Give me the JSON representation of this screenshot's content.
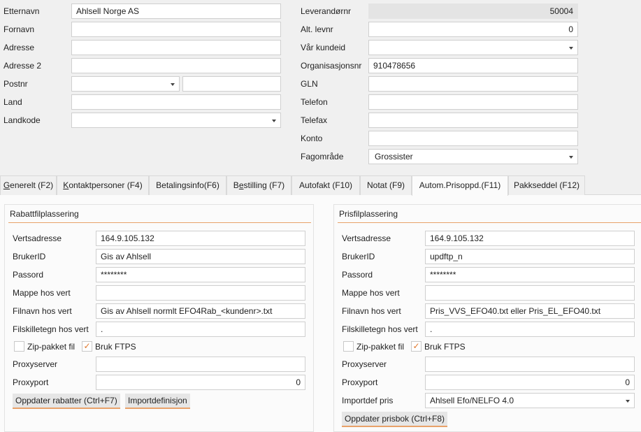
{
  "top_left": {
    "etternavn_label": "Etternavn",
    "etternavn_value": "Ahlsell Norge AS",
    "fornavn_label": "Fornavn",
    "fornavn_value": "",
    "adresse_label": "Adresse",
    "adresse_value": "",
    "adresse2_label": "Adresse 2",
    "adresse2_value": "",
    "postnr_label": "Postnr",
    "postnr_value": "",
    "poststed_value": "",
    "land_label": "Land",
    "land_value": "",
    "landkode_label": "Landkode",
    "landkode_value": ""
  },
  "top_right": {
    "levnr_label": "Leverandørnr",
    "levnr_value": "50004",
    "altlevnr_label": "Alt. levnr",
    "altlevnr_value": "0",
    "kundeid_label": "Vår kundeid",
    "kundeid_value": "",
    "orgnr_label": "Organisasjonsnr",
    "orgnr_value": "910478656",
    "gln_label": "GLN",
    "gln_value": "",
    "telefon_label": "Telefon",
    "telefon_value": "",
    "telefax_label": "Telefax",
    "telefax_value": "",
    "konto_label": "Konto",
    "konto_value": "",
    "fagomrade_label": "Fagområde",
    "fagomrade_value": "Grossister"
  },
  "tabs": [
    {
      "mn": "G",
      "rest": "enerelt (F2)"
    },
    {
      "mn": "K",
      "rest": "ontaktpersoner (F4)"
    },
    {
      "pre": "Betalingsinfo(F6)"
    },
    {
      "pre": "B",
      "mn": "e",
      "rest": "stilling (F7)"
    },
    {
      "pre": "Autofakt (F10)"
    },
    {
      "pre": "Notat (F9)"
    },
    {
      "pre": "Autom.Prisoppd.(F11)"
    },
    {
      "pre": "Pakkseddel (F12)"
    }
  ],
  "rabatt": {
    "title": "Rabattfilplassering",
    "vert_label": "Vertsadresse",
    "vert_value": "164.9.105.132",
    "bruker_label": "BrukerID",
    "bruker_value": "Gis av Ahlsell",
    "passord_label": "Passord",
    "passord_value": "********",
    "mappe_label": "Mappe hos vert",
    "mappe_value": "",
    "filnavn_label": "Filnavn hos vert",
    "filnavn_value": "Gis av Ahlsell normlt EFO4Rab_<kundenr>.txt",
    "skille_label": "Filskilletegn hos vert",
    "skille_value": ".",
    "zip_label": "Zip-pakket fil",
    "ftps_label": "Bruk FTPS",
    "proxy_label": "Proxyserver",
    "proxy_value": "",
    "port_label": "Proxyport",
    "port_value": "0",
    "btn_update": "Oppdater rabatter (Ctrl+F7)",
    "btn_import": "Importdefinisjon"
  },
  "pris": {
    "title": "Prisfilplassering",
    "vert_label": "Vertsadresse",
    "vert_value": "164.9.105.132",
    "bruker_label": "BrukerID",
    "bruker_value": "updftp_n",
    "passord_label": "Passord",
    "passord_value": "********",
    "mappe_label": "Mappe hos vert",
    "mappe_value": "",
    "filnavn_label": "Filnavn hos vert",
    "filnavn_value": "Pris_VVS_EFO40.txt eller Pris_EL_EFO40.txt",
    "skille_label": "Filskilletegn hos vert",
    "skille_value": ".",
    "zip_label": "Zip-pakket fil",
    "ftps_label": "Bruk FTPS",
    "proxy_label": "Proxyserver",
    "proxy_value": "",
    "port_label": "Proxyport",
    "port_value": "0",
    "importdef_label": "Importdef pris",
    "importdef_value": "Ahlsell Efo/NELFO 4.0",
    "btn_update": "Oppdater prisbok (Ctrl+F8)"
  },
  "check_glyph": "✓",
  "accent_color": "#e8a26a"
}
